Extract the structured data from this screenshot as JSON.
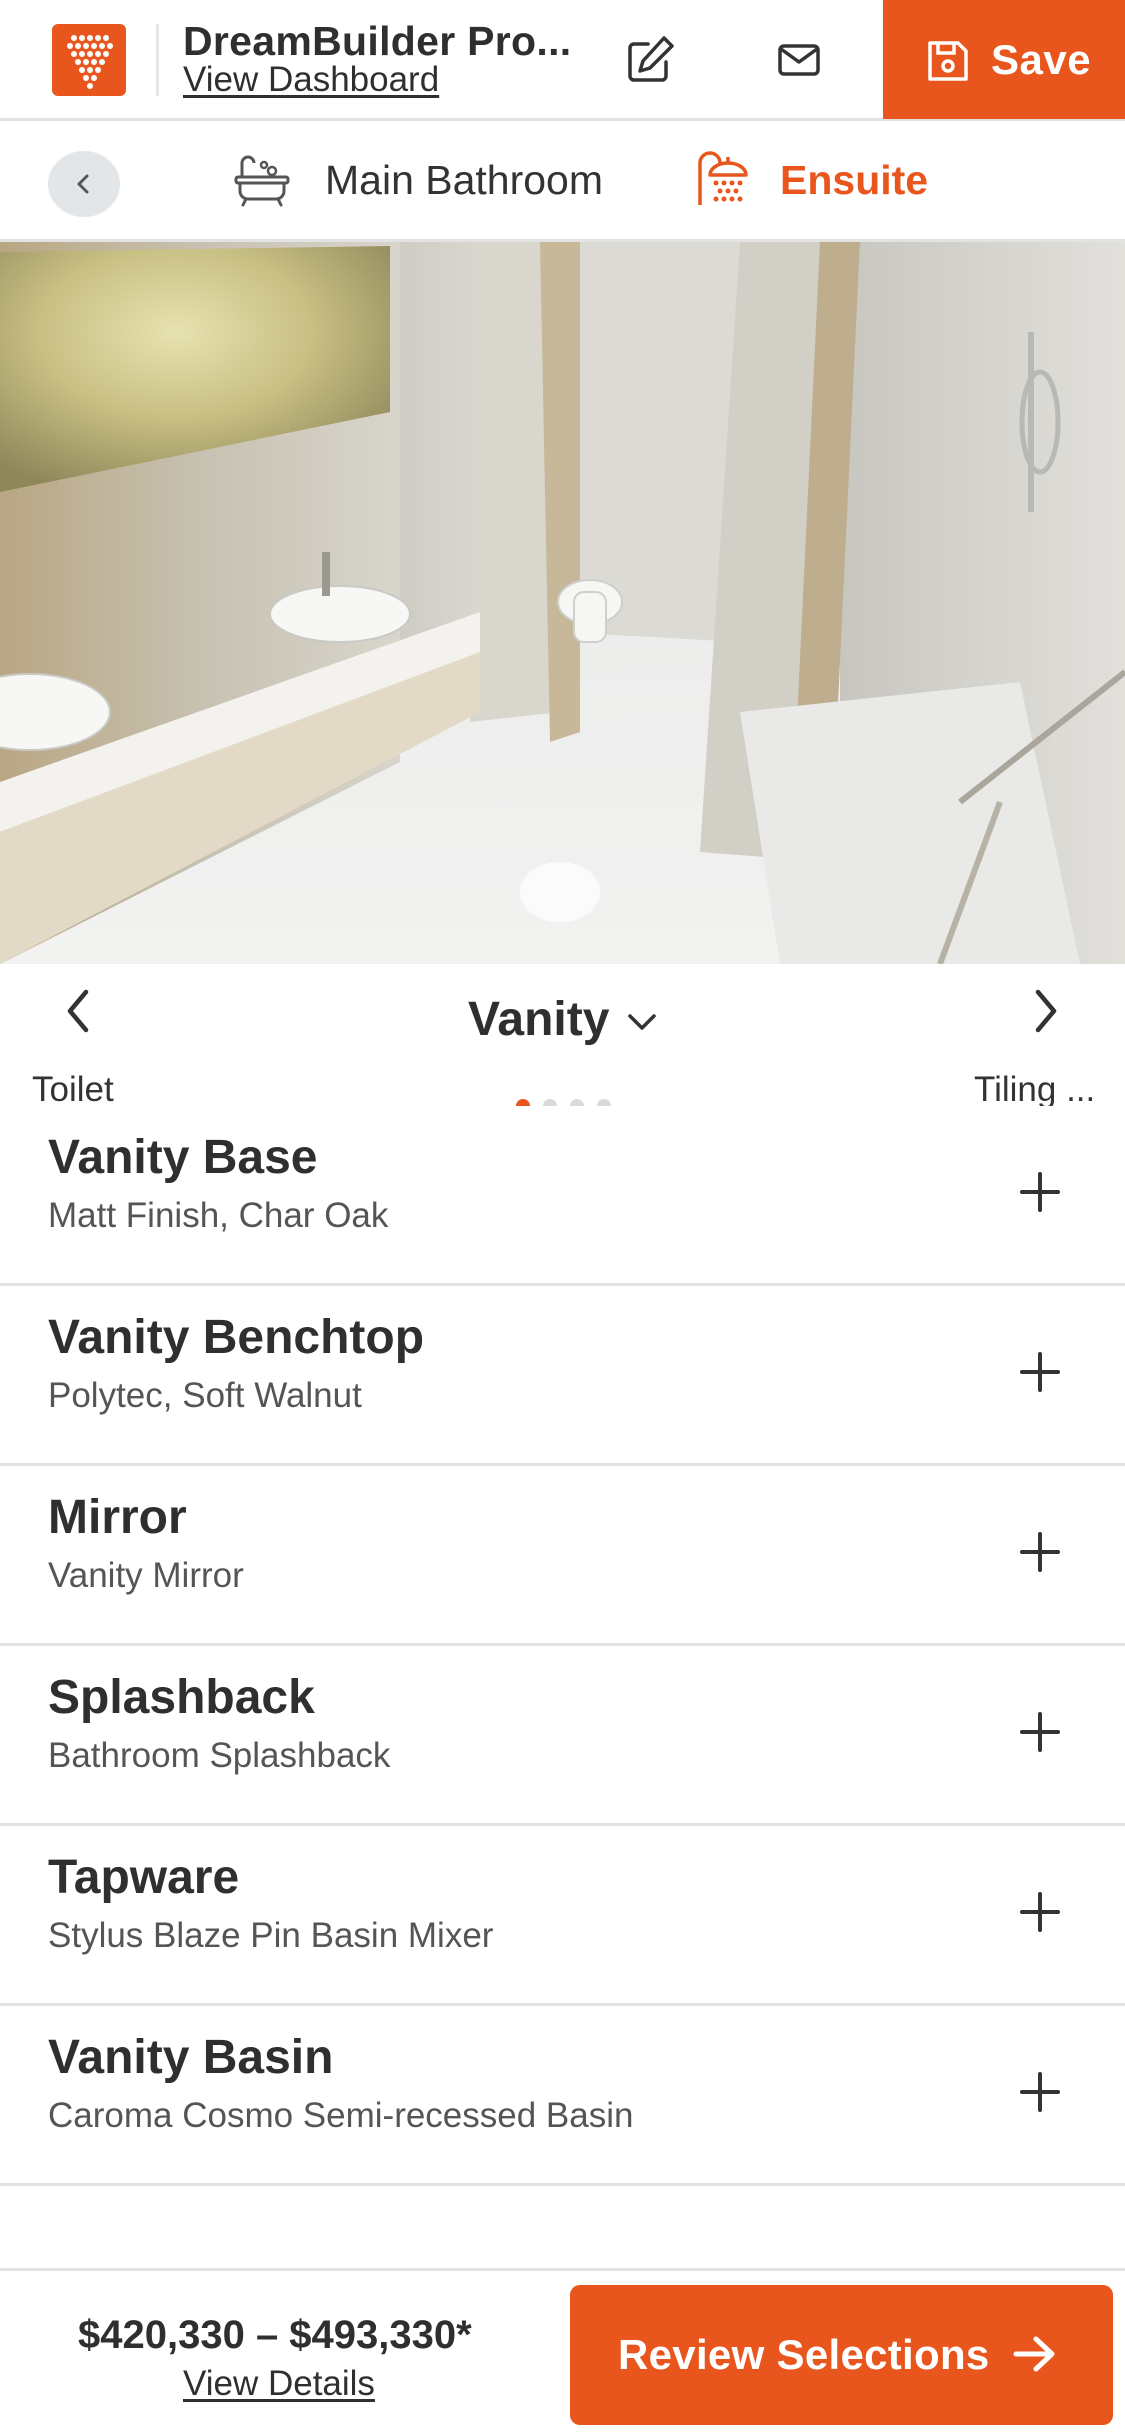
{
  "header": {
    "project_title": "DreamBuilder Pro...",
    "dashboard_link": "View Dashboard",
    "save_label": "Save",
    "icons": {
      "logo": "dreambuilder-logo",
      "edit": "pencil-icon",
      "mail": "envelope-icon",
      "save": "floppy-disk-icon"
    }
  },
  "rooms": {
    "tabs": [
      {
        "label": "Main Bathroom",
        "icon": "bathtub-icon",
        "active": false
      },
      {
        "label": "Ensuite",
        "icon": "shower-icon",
        "active": true
      }
    ]
  },
  "category_nav": {
    "prev_label": "Toilet",
    "current_label": "Vanity",
    "next_label": "Tiling ...",
    "page_count": 4,
    "active_page": 1
  },
  "selections": [
    {
      "title": "Vanity Base",
      "subtitle": "Matt Finish, Char Oak"
    },
    {
      "title": "Vanity Benchtop",
      "subtitle": "Polytec, Soft Walnut"
    },
    {
      "title": "Mirror",
      "subtitle": "Vanity Mirror"
    },
    {
      "title": "Splashback",
      "subtitle": "Bathroom Splashback"
    },
    {
      "title": "Tapware",
      "subtitle": "Stylus Blaze Pin Basin Mixer"
    },
    {
      "title": "Vanity Basin",
      "subtitle": "Caroma Cosmo Semi-recessed Basin"
    }
  ],
  "footer": {
    "price_range": "$420,330 – $493,330*",
    "details_link": "View Details",
    "review_label": "Review Selections"
  },
  "colors": {
    "accent": "#e8561d",
    "text": "#2f2f2f",
    "divider": "#e3e3e3"
  }
}
